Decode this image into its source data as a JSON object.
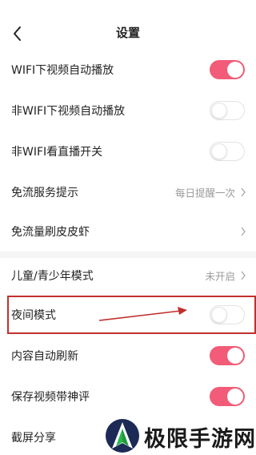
{
  "header": {
    "title": "设置"
  },
  "rows": [
    {
      "label": "WIFI下视频自动播放"
    },
    {
      "label": "非WIFI下视频自动播放"
    },
    {
      "label": "非WIFI看直播开关"
    },
    {
      "label": "免流服务提示",
      "value": "每日提醒一次"
    },
    {
      "label": "免流量刷皮皮虾"
    },
    {
      "label": "儿童/青少年模式",
      "value": "未开启"
    },
    {
      "label": "夜间模式"
    },
    {
      "label": "内容自动刷新"
    },
    {
      "label": "保存视频带神评"
    },
    {
      "label": "截屏分享"
    }
  ],
  "toggles": {
    "wifi_autoplay": "on",
    "non_wifi_autoplay": "off",
    "non_wifi_live": "off",
    "night_mode": "off",
    "content_auto_refresh": "on",
    "save_video_comment": "on"
  },
  "watermark": {
    "text": "极限手游网"
  },
  "colors": {
    "toggle_on": "#f25c78",
    "highlight": "#c0302e",
    "watermark_green": "#1e9a3a",
    "watermark_navy": "#1c2a55"
  },
  "icons": {
    "back": "chevron-left-icon",
    "chevron": "chevron-right-icon"
  }
}
